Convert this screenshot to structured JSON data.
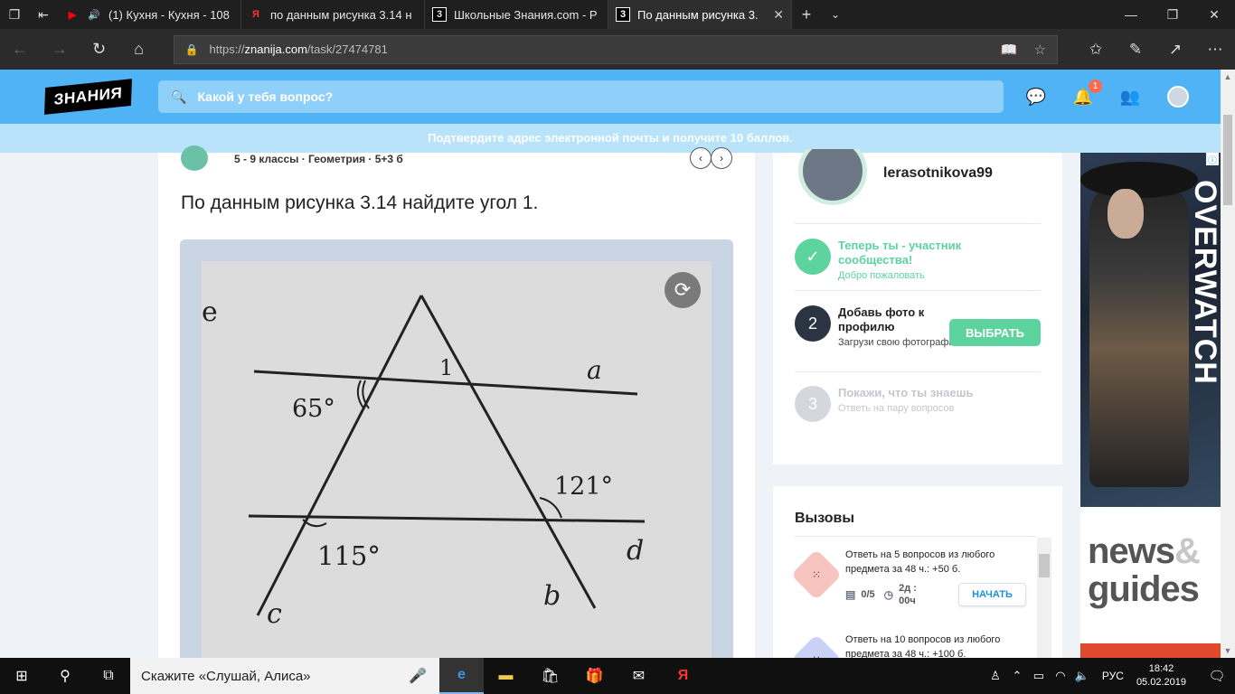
{
  "browser": {
    "tabs": [
      {
        "title": "(1) Кухня - Кухня - 108",
        "favicon": "▶",
        "favicon_color": "#ff0000",
        "audio": true
      },
      {
        "title": "по данным рисунка 3.14 н",
        "favicon": "Я",
        "favicon_color": "#ff3333"
      },
      {
        "title": "Школьные Знания.com - Р",
        "favicon": "3",
        "favicon_color": "#ffffff"
      },
      {
        "title": "По данным рисунка 3.",
        "favicon": "3",
        "favicon_color": "#ffffff",
        "active": true
      }
    ],
    "url_prefix": "https://",
    "url_host": "znanija.com",
    "url_path": "/task/27474781"
  },
  "site": {
    "logo": "ЗНАНИЯ",
    "search_placeholder": "Какой у тебя вопрос?",
    "notifications_count": "1",
    "banner": "Подтвердите адрес электронной почты и получите 10 баллов."
  },
  "question": {
    "meta": "5 - 9 классы · Геометрия · 5+3 б",
    "title": "По данным рисунка 3.14 найдите угол 1.",
    "figure": {
      "labels": {
        "e": "e",
        "a": "a",
        "angle1": "1",
        "angle65": "65°",
        "angle121": "121°",
        "angle115": "115°",
        "d": "d",
        "b": "b",
        "c": "c"
      }
    }
  },
  "profile": {
    "username": "lerasotnikova99",
    "steps": [
      {
        "num": "✓",
        "title": "Теперь ты - участник сообщества!",
        "sub": "Добро пожаловать",
        "color": "#5dd39e"
      },
      {
        "num": "2",
        "title": "Добавь фото к профилю",
        "sub": "Загрузи свою фотографию",
        "color": "#2b3443",
        "button": "ВЫБРАТЬ"
      },
      {
        "num": "3",
        "title": "Покажи, что ты знаешь",
        "sub": "Ответь на пару вопросов",
        "color": "#d4d8de"
      }
    ]
  },
  "challenges": {
    "title": "Вызовы",
    "items": [
      {
        "text": "Ответь на 5 вопросов из любого предмета за 48 ч.: +50 б.",
        "progress": "0/5",
        "time": "2д : 00ч",
        "button": "НАЧАТЬ",
        "icon_color": "#f7c4c0"
      },
      {
        "text": "Ответь на 10 вопросов из любого предмета за 48 ч.: +100 б.",
        "icon_color": "#c9d2f5"
      }
    ]
  },
  "ad": {
    "brand": "OVERWATCH",
    "news1": "news",
    "amp": "&",
    "news2": "guides"
  },
  "taskbar": {
    "search_text": "Скажите «Слушай, Алиса»",
    "lang": "РУС",
    "time": "18:42",
    "date": "05.02.2019"
  }
}
